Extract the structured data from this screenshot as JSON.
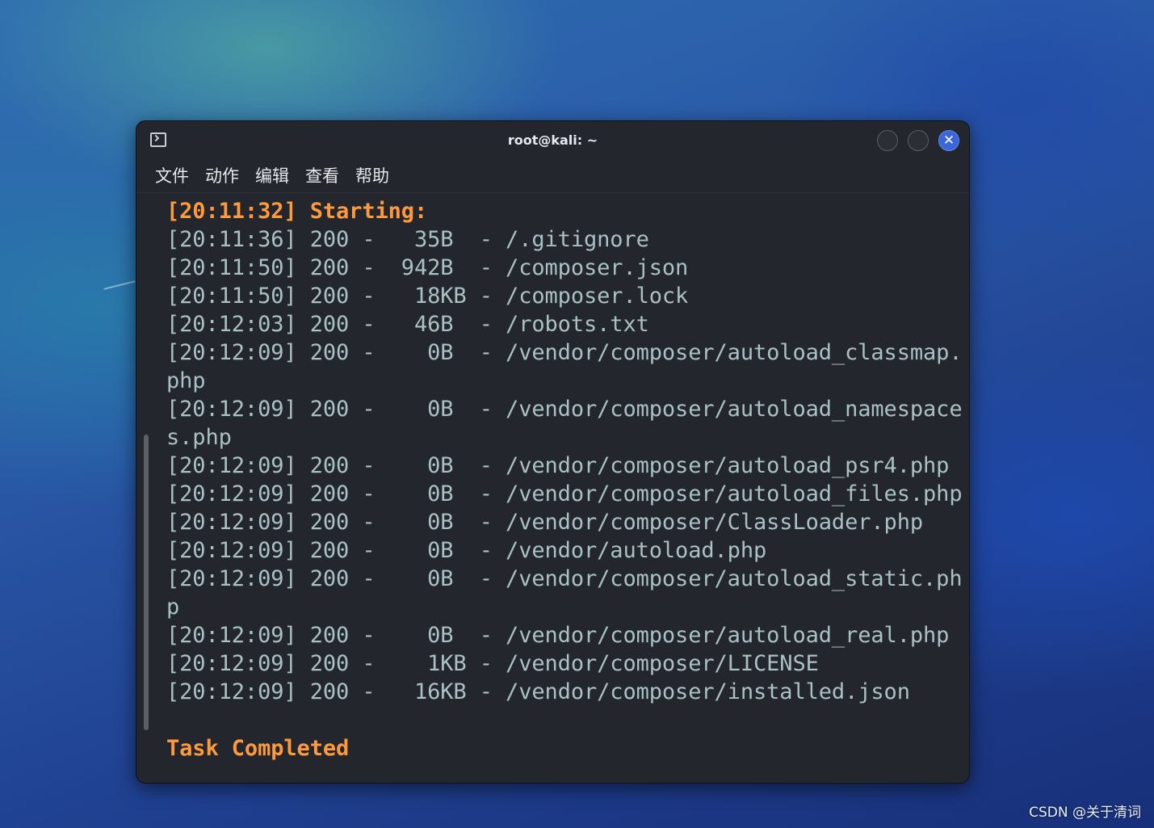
{
  "window": {
    "title": "root@kali: ~",
    "close_glyph": "✕",
    "icons": {
      "app": "terminal-icon",
      "minimize": "minimize-icon",
      "maximize": "maximize-icon",
      "close": "close-icon"
    }
  },
  "menu": {
    "items": [
      "文件",
      "动作",
      "编辑",
      "查看",
      "帮助"
    ]
  },
  "terminal": {
    "accent_color": "#ff9a3c",
    "text_color": "#a9c1c4",
    "lines": [
      {
        "text": "[20:11:32] Starting:",
        "style": "accent"
      },
      {
        "text": "[20:11:36] 200 -   35B  - /.gitignore",
        "style": "normal"
      },
      {
        "text": "[20:11:50] 200 -  942B  - /composer.json",
        "style": "normal"
      },
      {
        "text": "[20:11:50] 200 -   18KB - /composer.lock",
        "style": "normal"
      },
      {
        "text": "[20:12:03] 200 -   46B  - /robots.txt",
        "style": "normal"
      },
      {
        "text": "[20:12:09] 200 -    0B  - /vendor/composer/autoload_classmap.",
        "style": "normal"
      },
      {
        "text": "php",
        "style": "normal"
      },
      {
        "text": "[20:12:09] 200 -    0B  - /vendor/composer/autoload_namespace",
        "style": "normal"
      },
      {
        "text": "s.php",
        "style": "normal"
      },
      {
        "text": "[20:12:09] 200 -    0B  - /vendor/composer/autoload_psr4.php",
        "style": "normal"
      },
      {
        "text": "[20:12:09] 200 -    0B  - /vendor/composer/autoload_files.php",
        "style": "normal"
      },
      {
        "text": "[20:12:09] 200 -    0B  - /vendor/composer/ClassLoader.php",
        "style": "normal"
      },
      {
        "text": "[20:12:09] 200 -    0B  - /vendor/autoload.php",
        "style": "normal"
      },
      {
        "text": "[20:12:09] 200 -    0B  - /vendor/composer/autoload_static.ph",
        "style": "normal"
      },
      {
        "text": "p",
        "style": "normal"
      },
      {
        "text": "[20:12:09] 200 -    0B  - /vendor/composer/autoload_real.php",
        "style": "normal"
      },
      {
        "text": "[20:12:09] 200 -    1KB - /vendor/composer/LICENSE",
        "style": "normal"
      },
      {
        "text": "[20:12:09] 200 -   16KB - /vendor/composer/installed.json",
        "style": "normal"
      },
      {
        "text": "",
        "style": "normal"
      },
      {
        "text": "Task Completed",
        "style": "accent"
      }
    ]
  },
  "watermark": "CSDN @关于清词"
}
